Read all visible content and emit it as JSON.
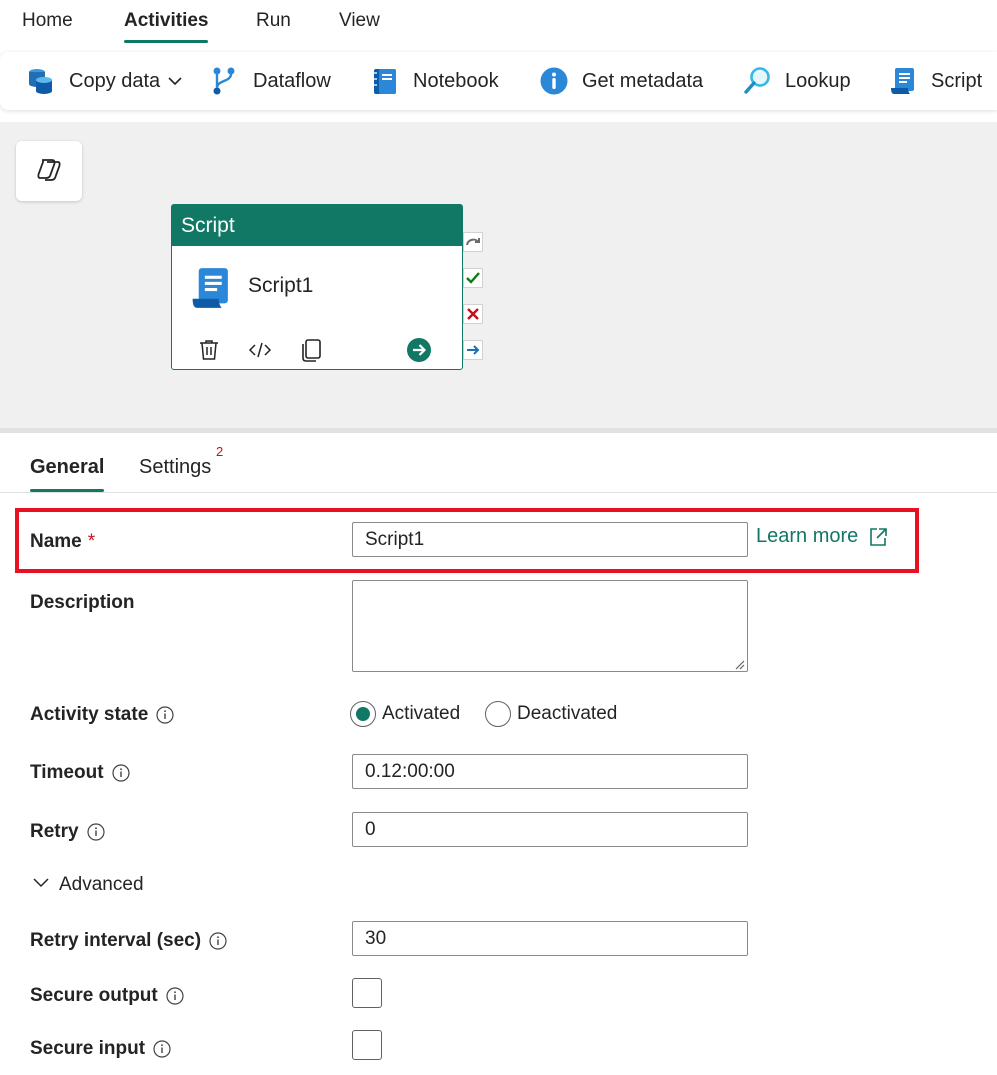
{
  "menu": {
    "tabs": [
      {
        "label": "Home"
      },
      {
        "label": "Activities"
      },
      {
        "label": "Run"
      },
      {
        "label": "View"
      }
    ],
    "active": "Activities"
  },
  "ribbon": {
    "items": [
      {
        "label": "Copy data",
        "icon": "copy-data-icon"
      },
      {
        "label": "Dataflow",
        "icon": "dataflow-icon"
      },
      {
        "label": "Notebook",
        "icon": "notebook-icon"
      },
      {
        "label": "Get metadata",
        "icon": "info-icon"
      },
      {
        "label": "Lookup",
        "icon": "lookup-icon"
      },
      {
        "label": "Script",
        "icon": "script-icon"
      }
    ]
  },
  "canvas": {
    "node": {
      "header": "Script",
      "name": "Script1",
      "icon": "script-icon",
      "actions": [
        "delete-icon",
        "code-icon",
        "copy-icon",
        "go-arrow-icon"
      ]
    },
    "ports": [
      "skip-icon",
      "success-check-icon",
      "failure-x-icon",
      "completion-arrow-icon"
    ]
  },
  "panel": {
    "tabs": [
      {
        "label": "General"
      },
      {
        "label": "Settings",
        "badge": "2"
      }
    ],
    "active": "General"
  },
  "form": {
    "name_label": "Name",
    "name_required": "*",
    "name_value": "Script1",
    "learn_more": "Learn more",
    "description_label": "Description",
    "description_value": "",
    "activity_state_label": "Activity state",
    "activity_state_options": [
      "Activated",
      "Deactivated"
    ],
    "activity_state_selected": "Activated",
    "timeout_label": "Timeout",
    "timeout_value": "0.12:00:00",
    "retry_label": "Retry",
    "retry_value": "0",
    "advanced_label": "Advanced",
    "retry_interval_label": "Retry interval (sec)",
    "retry_interval_value": "30",
    "secure_output_label": "Secure output",
    "secure_output_checked": false,
    "secure_input_label": "Secure input",
    "secure_input_checked": false
  },
  "colors": {
    "accent": "#117865",
    "highlight": "#e81123",
    "required": "#c50f1f"
  }
}
